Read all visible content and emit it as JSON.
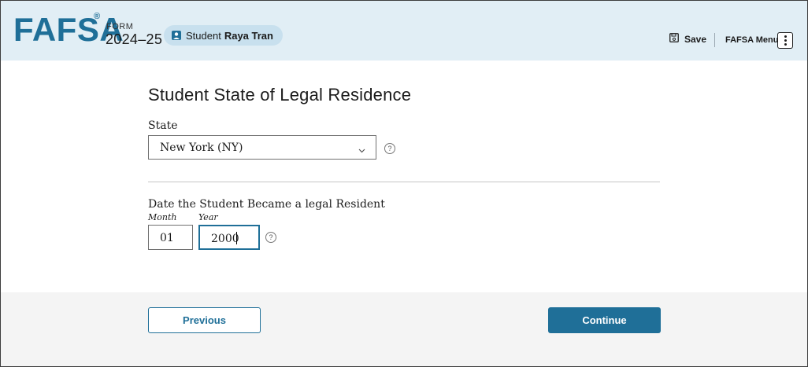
{
  "header": {
    "logo": "FAFSA",
    "logo_mark": "®",
    "form_label": "FORM",
    "form_year": "2024–25",
    "student_prefix": "Student",
    "student_name": "Raya Tran",
    "save_label": "Save",
    "menu_label": "FAFSA Menu"
  },
  "main": {
    "title": "Student State of Legal Residence",
    "state_label": "State",
    "state_value": "New York (NY)",
    "date_label": "Date the Student Became a legal Resident",
    "month_label": "Month",
    "month_value": "01",
    "year_label": "Year",
    "year_value": "2000",
    "help_glyph": "?"
  },
  "footer": {
    "previous_label": "Previous",
    "continue_label": "Continue"
  },
  "colors": {
    "brand": "#1f6f98",
    "header_bg": "#e1eef5",
    "pill_bg": "#c8e0ee",
    "footer_bg": "#f4f4f4"
  },
  "icons": [
    "student-icon",
    "save-icon",
    "kebab-menu-icon",
    "chevron-down-icon",
    "help-icon"
  ]
}
